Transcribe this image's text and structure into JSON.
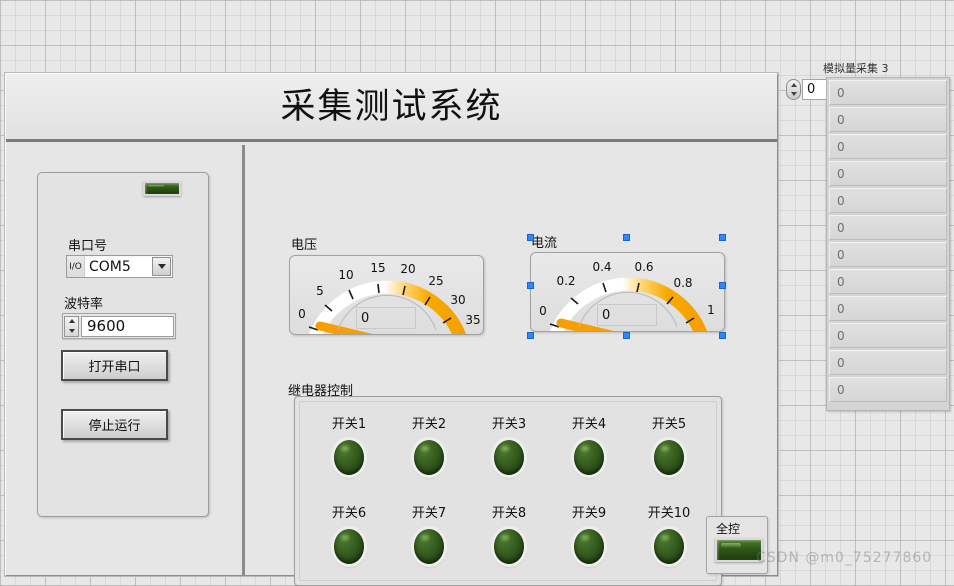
{
  "app": {
    "title": "采集测试系统"
  },
  "serial_panel": {
    "indicator_name": "connection-led",
    "port_label": "串口号",
    "port_glyph": "I/O",
    "port_value": "COM5",
    "baud_label": "波特率",
    "baud_value": "9600",
    "open_button": "打开串口",
    "stop_button": "停止运行"
  },
  "gauges": [
    {
      "caption": "电压",
      "value": "0",
      "min": 0,
      "max": 35,
      "ticks": [
        "0",
        "5",
        "10",
        "15",
        "20",
        "25",
        "30",
        "35"
      ],
      "selected": false
    },
    {
      "caption": "电流",
      "value": "0",
      "min": 0,
      "max": 1,
      "ticks": [
        "0",
        "0.2",
        "0.4",
        "0.6",
        "0.8",
        "1"
      ],
      "selected": true
    }
  ],
  "relay": {
    "caption": "继电器控制",
    "switches": [
      {
        "label": "开关1",
        "state": "off"
      },
      {
        "label": "开关2",
        "state": "off"
      },
      {
        "label": "开关3",
        "state": "off"
      },
      {
        "label": "开关4",
        "state": "off"
      },
      {
        "label": "开关5",
        "state": "off"
      },
      {
        "label": "开关6",
        "state": "off"
      },
      {
        "label": "开关7",
        "state": "off"
      },
      {
        "label": "开关8",
        "state": "off"
      },
      {
        "label": "开关9",
        "state": "off"
      },
      {
        "label": "开关10",
        "state": "off"
      }
    ]
  },
  "full_control": {
    "caption": "全控",
    "state": "off"
  },
  "array": {
    "caption": "模拟量采集 3",
    "index_value": "0",
    "cells": [
      "0",
      "0",
      "0",
      "0",
      "0",
      "0",
      "0",
      "0",
      "0",
      "0",
      "0",
      "0"
    ]
  },
  "watermark": "CSDN @m0_75277860",
  "colors": {
    "gauge_scale_start": "#ffffff",
    "gauge_scale_end": "#f5a800",
    "led_on": "#3a6a1f",
    "selection_handle": "#2f86ff",
    "panel_bg": "#e6e6e6"
  }
}
